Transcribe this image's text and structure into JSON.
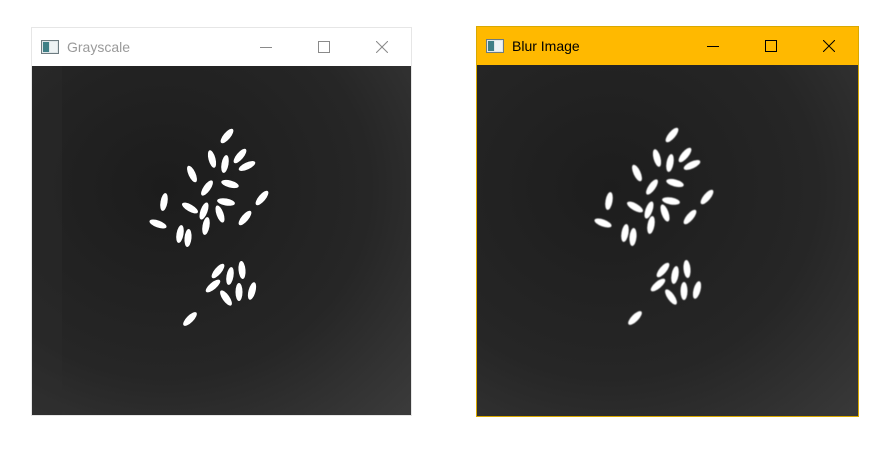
{
  "windows": [
    {
      "title": "Grayscale",
      "state": "inactive",
      "titlebar_color": "#ffffff",
      "controls": [
        "minimize-icon",
        "maximize-icon",
        "close-icon"
      ]
    },
    {
      "title": "Blur Image",
      "state": "active",
      "titlebar_color": "#ffb900",
      "controls": [
        "minimize-icon",
        "maximize-icon",
        "close-icon"
      ]
    }
  ],
  "image": {
    "subject": "rice grains",
    "background_color": "#2a2a2a",
    "grain_color": "#ffffff"
  }
}
